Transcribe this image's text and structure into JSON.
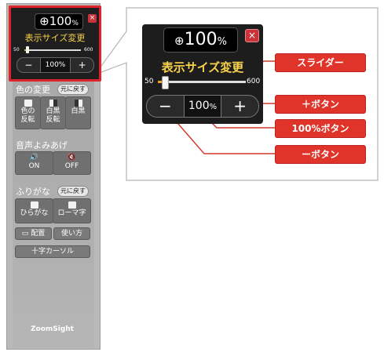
{
  "mini": {
    "zoom_icon": "zoom-in-icon",
    "zoom_value": "100",
    "zoom_unit": "%",
    "close": "×",
    "title": "表示サイズ変更",
    "slider_min": "50",
    "slider_max": "600",
    "slider_level_pct": 5,
    "btn_minus": "−",
    "btn_reset": "100%",
    "btn_plus": "+"
  },
  "sections": {
    "color": {
      "label": "色の変更",
      "reset": "元に戻す",
      "buttons": [
        "色の\n反転",
        "白黒\n反転",
        "白黒"
      ]
    },
    "voice": {
      "label": "音声よみあげ",
      "buttons": [
        "ON",
        "OFF"
      ]
    },
    "furigana": {
      "label": "ふりがな",
      "reset": "元に戻す",
      "buttons": [
        "ひらがな",
        "ローマ字"
      ]
    },
    "layout_btn": "配置",
    "howto_btn": "使い方",
    "cursor_btn": "十字カーソル"
  },
  "logo": {
    "brand": "ZoomSight"
  },
  "zoomed": {
    "zoom_value": "100",
    "zoom_unit": "%",
    "close": "×",
    "title": "表示サイズ変更",
    "slider_min": "50",
    "slider_max": "600",
    "btn_minus": "−",
    "btn_reset_value": "100",
    "btn_reset_unit": "%",
    "btn_plus": "+"
  },
  "callouts": {
    "slider": "スライダー",
    "plus": "＋ボタン",
    "reset": "100%ボタン",
    "minus": "ーボタン"
  },
  "colors": {
    "accent_red": "#e0332a",
    "title_yellow": "#f7d24a"
  }
}
